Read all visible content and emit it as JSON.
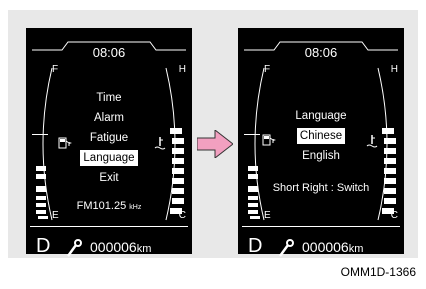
{
  "left_screen": {
    "time": "08:06",
    "fuel_top": "F",
    "fuel_bottom": "E",
    "temp_top": "H",
    "temp_bottom": "C",
    "menu": [
      "Time",
      "Alarm",
      "Fatigue",
      "Language",
      "Exit"
    ],
    "selected_item": "Language",
    "radio_freq": "FM101.25",
    "radio_unit": "kHz",
    "gear": "D",
    "odometer": "000006",
    "odo_unit": "km",
    "icons": [
      "fuel-pump-icon",
      "coolant-temp-icon",
      "wrench-icon"
    ]
  },
  "right_screen": {
    "time": "08:06",
    "fuel_top": "F",
    "fuel_bottom": "E",
    "temp_top": "H",
    "temp_bottom": "C",
    "title": "Language",
    "selected_option": "Chinese",
    "other_option": "English",
    "hint": "Short Right : Switch",
    "gear": "D",
    "odometer": "000006",
    "odo_unit": "km",
    "icons": [
      "fuel-pump-icon",
      "coolant-temp-icon",
      "wrench-icon"
    ]
  },
  "transition_arrow_color": "#f2a0c0",
  "caption": "OMM1D-1366"
}
